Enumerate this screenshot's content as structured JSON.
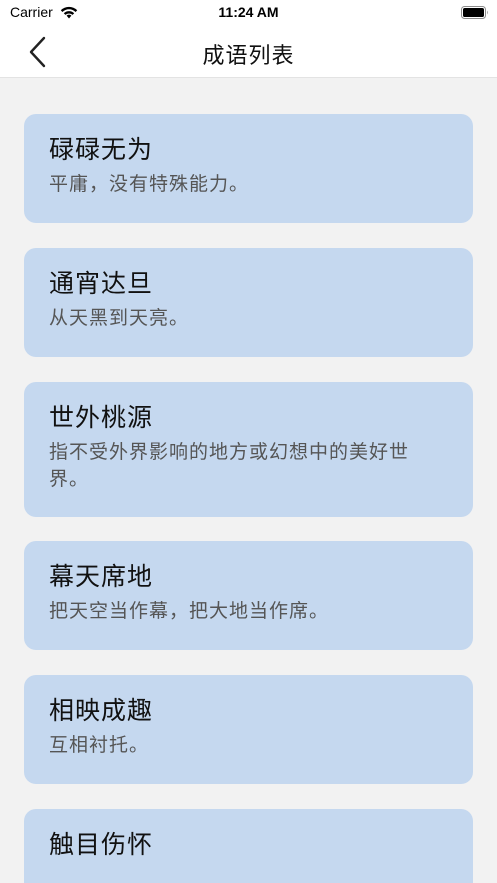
{
  "status_bar": {
    "carrier": "Carrier",
    "time": "11:24 AM"
  },
  "nav": {
    "title": "成语列表",
    "back_icon": "chevron-left-icon"
  },
  "idioms": [
    {
      "title": "碌碌无为",
      "desc": "平庸，没有特殊能力。"
    },
    {
      "title": "通宵达旦",
      "desc": "从天黑到天亮。"
    },
    {
      "title": "世外桃源",
      "desc": "指不受外界影响的地方或幻想中的美好世界。"
    },
    {
      "title": "幕天席地",
      "desc": "把天空当作幕，把大地当作席。"
    },
    {
      "title": "相映成趣",
      "desc": "互相衬托。"
    },
    {
      "title": "触目伤怀",
      "desc": ""
    }
  ],
  "colors": {
    "card_bg": "#c5d8ef",
    "page_bg": "#f2f2f2",
    "nav_bg": "#ffffff"
  }
}
